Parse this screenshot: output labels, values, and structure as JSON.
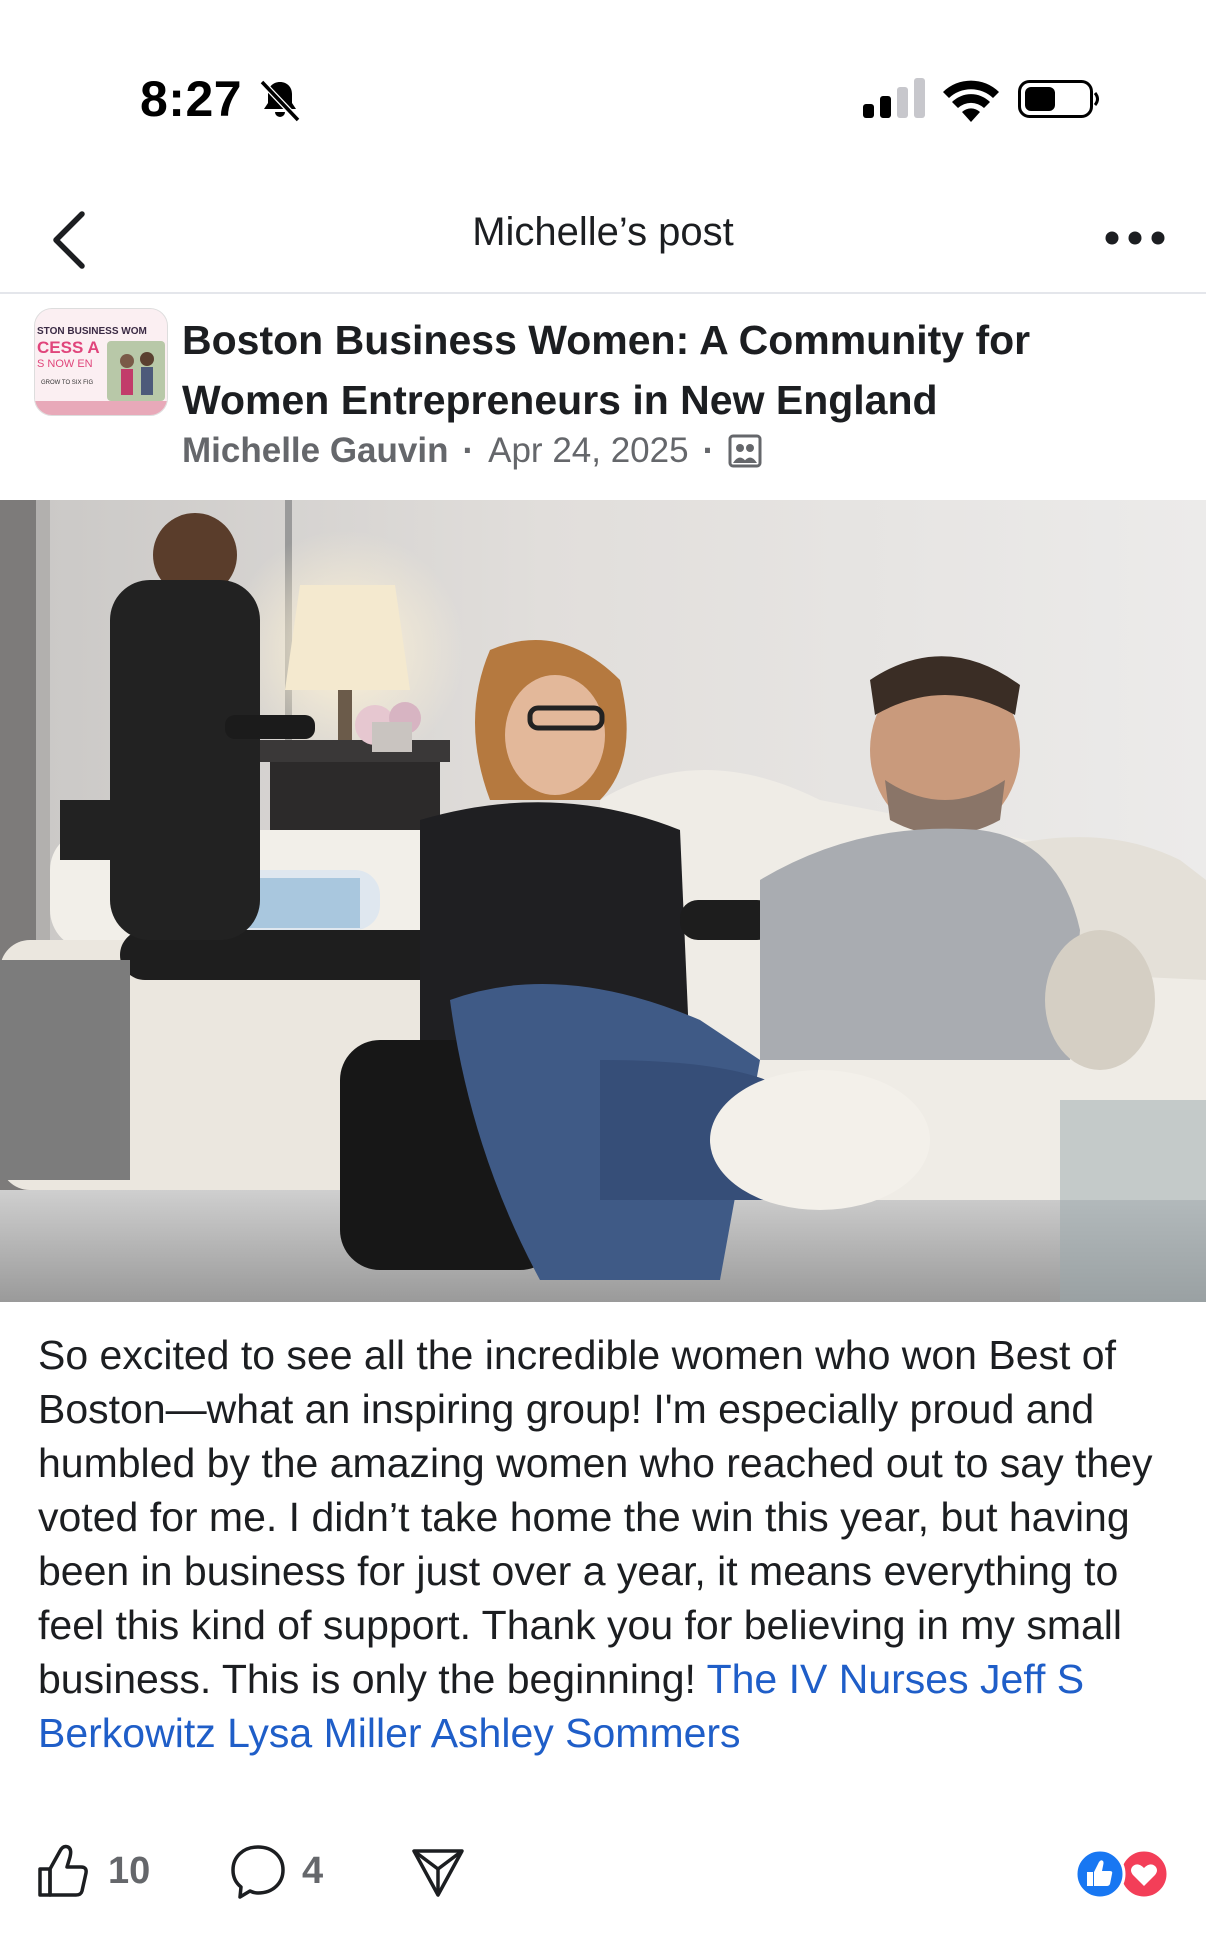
{
  "status_bar": {
    "time": "8:27",
    "icons": [
      "bell-slash-icon",
      "cellular-signal-icon",
      "wifi-icon",
      "battery-icon"
    ]
  },
  "nav": {
    "title": "Michelle’s post",
    "back_icon": "chevron-left-icon",
    "more_icon": "ellipsis-icon"
  },
  "post": {
    "group_name": "Boston Business Women: A Community for Women Entrepreneurs in New England",
    "avatar_text": {
      "line1": "STON BUSINESS WOM",
      "line2": "CESS A",
      "line3": "S NOW EN",
      "line4": "GROW TO SIX FIG"
    },
    "author": "Michelle Gauvin",
    "separator": "·",
    "date": "Apr 24, 2025",
    "audience_icon": "group-audience-icon",
    "text": "So excited to see all the incredible women who won Best of Boston—what an inspiring group! I'm especially proud and humbled by the amazing women who reached out to say they voted for me. I didn’t take home the win this year, but having been in business for just over a year, it means everything to feel this kind of support. Thank you for believing in my small business. This is only the beginning! ",
    "tags": [
      "The IV Nurses",
      "Jeff S Berkowitz",
      "Lysa Miller",
      "Ashley Sommers"
    ]
  },
  "actions": {
    "like_count": "10",
    "comment_count": "4",
    "like_icon": "thumbs-up-icon",
    "comment_icon": "comment-bubble-icon",
    "share_icon": "share-icon",
    "reaction_icons": [
      "like-reaction-icon",
      "love-reaction-icon"
    ]
  },
  "colors": {
    "link": "#1f5ec8",
    "meta_gray": "#65676b",
    "like_blue": "#1877f2",
    "love_red": "#f33e58"
  }
}
